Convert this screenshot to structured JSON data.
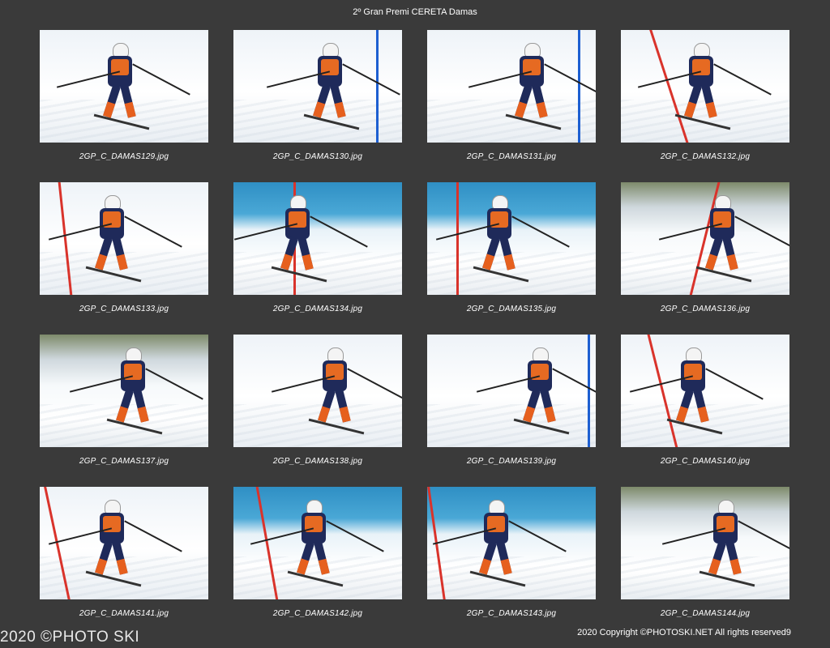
{
  "page": {
    "title": "2º Gran Premi CERETA Damas",
    "footer_left": "2020 ©PHOTO SKI",
    "footer_right": "2020 Copyright ©PHOTOSKI.NET All rights reserved",
    "page_number": "9"
  },
  "photos": [
    {
      "caption": "2GP_C_DAMAS129.jpg",
      "bg": "sky"
    },
    {
      "caption": "2GP_C_DAMAS130.jpg",
      "bg": "plain"
    },
    {
      "caption": "2GP_C_DAMAS131.jpg",
      "bg": "plain"
    },
    {
      "caption": "2GP_C_DAMAS132.jpg",
      "bg": "plain"
    },
    {
      "caption": "2GP_C_DAMAS133.jpg",
      "bg": "plain"
    },
    {
      "caption": "2GP_C_DAMAS134.jpg",
      "bg": "blue-fence"
    },
    {
      "caption": "2GP_C_DAMAS135.jpg",
      "bg": "blue-fence"
    },
    {
      "caption": "2GP_C_DAMAS136.jpg",
      "bg": "trees"
    },
    {
      "caption": "2GP_C_DAMAS137.jpg",
      "bg": "trees"
    },
    {
      "caption": "2GP_C_DAMAS138.jpg",
      "bg": "plain"
    },
    {
      "caption": "2GP_C_DAMAS139.jpg",
      "bg": "plain"
    },
    {
      "caption": "2GP_C_DAMAS140.jpg",
      "bg": "plain"
    },
    {
      "caption": "2GP_C_DAMAS141.jpg",
      "bg": "plain"
    },
    {
      "caption": "2GP_C_DAMAS142.jpg",
      "bg": "blue-fence"
    },
    {
      "caption": "2GP_C_DAMAS143.jpg",
      "bg": "blue-fence"
    },
    {
      "caption": "2GP_C_DAMAS144.jpg",
      "bg": "trees"
    }
  ]
}
